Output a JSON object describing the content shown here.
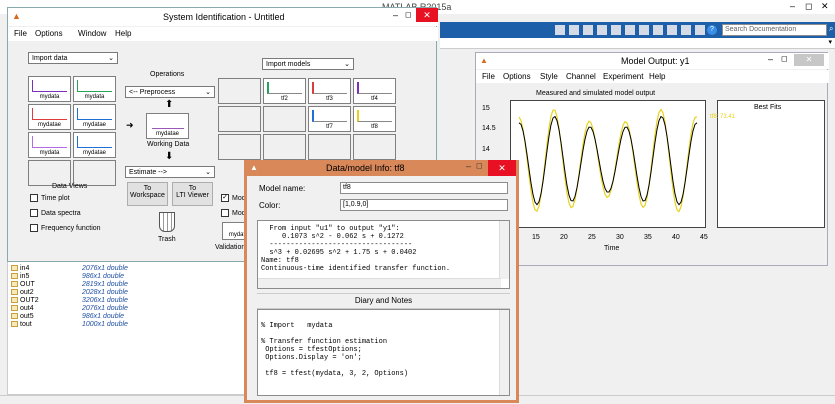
{
  "matlab": {
    "title": "MATLAB R2015a",
    "search_placeholder": "Search Documentation",
    "window_controls": {
      "min": "–",
      "max": "◻",
      "close": "✕"
    }
  },
  "workspace": {
    "rows": [
      {
        "name": "in4",
        "value": "2076x1 double"
      },
      {
        "name": "in5",
        "value": "986x1 double"
      },
      {
        "name": "OUT",
        "value": "2819x1 double"
      },
      {
        "name": "out2",
        "value": "2028x1 double"
      },
      {
        "name": "OUT2",
        "value": "3206x1 double"
      },
      {
        "name": "out4",
        "value": "2076x1 double"
      },
      {
        "name": "out5",
        "value": "986x1 double"
      },
      {
        "name": "tout",
        "value": "1000x1 double"
      }
    ]
  },
  "sysid": {
    "title": "System Identification - Untitled",
    "menu": [
      "File",
      "Options",
      "Window",
      "Help"
    ],
    "import_data": "Import data",
    "operations_label": "Operations",
    "preprocess": "<-- Preprocess",
    "working_data_label": "Working Data",
    "working_data_name": "mydatae",
    "estimate": "Estimate -->",
    "import_models": "Import models",
    "data_slots": [
      "mydata",
      "mydata",
      "mydatae",
      "mydatae",
      "mydata",
      "mydatae",
      "",
      "",
      "",
      "",
      "",
      ""
    ],
    "model_slots": [
      "",
      "tf2",
      "tf3",
      "tf4",
      "",
      "",
      "tf7",
      "tf8",
      "",
      "",
      "",
      ""
    ],
    "data_views_label": "Data Views",
    "time_plot": "Time plot",
    "data_spectra": "Data spectra",
    "frequency_function": "Frequency function",
    "to_workspace_1": "To",
    "to_workspace_2": "Workspace",
    "to_ltiviewer_1": "To",
    "to_ltiviewer_2": "LTI Viewer",
    "trash": "Trash",
    "model_output_check": "Mode",
    "model_check2": "Mode",
    "validation": "Validation",
    "mydata_partial": "mydat"
  },
  "model_output": {
    "title": "Model Output: y1",
    "menu": [
      "File",
      "Options",
      "Style",
      "Channel",
      "Experiment",
      "Help"
    ],
    "plot_title": "Measured and simulated model output",
    "best_fits_label": "Best Fits",
    "best_fits_entry": "tf8: 73.41",
    "xlabel": "Time",
    "xticks": [
      "15",
      "20",
      "25",
      "30",
      "35",
      "40",
      "45"
    ],
    "yticks": [
      "15",
      "14.5",
      "14"
    ]
  },
  "info": {
    "title": "Data/model Info: tf8",
    "model_name_label": "Model name:",
    "model_name_value": "tf8",
    "color_label": "Color:",
    "color_value": "[1,0.9,0]",
    "text_lines": [
      "  From input \"u1\" to output \"y1\":",
      "     0.1073 s^2 - 0.062 s + 0.1272",
      "  ----------------------------------",
      "  s^3 + 0.02695 s^2 + 1.75 s + 0.0402",
      "Name: tf8",
      "Continuous-time identified transfer function."
    ],
    "diary_label": "Diary and Notes",
    "diary_lines": [
      "",
      "% Import   mydata",
      "",
      "% Transfer function estimation",
      " Options = tfestOptions;",
      " Options.Display = 'on';",
      "",
      " tf8 = tfest(mydata, 3, 2, Options)"
    ]
  },
  "colors": {
    "plot_measured": "#000000",
    "plot_model": "#e6d21c",
    "close_red": "#e81123",
    "info_frame": "#d9885a"
  }
}
